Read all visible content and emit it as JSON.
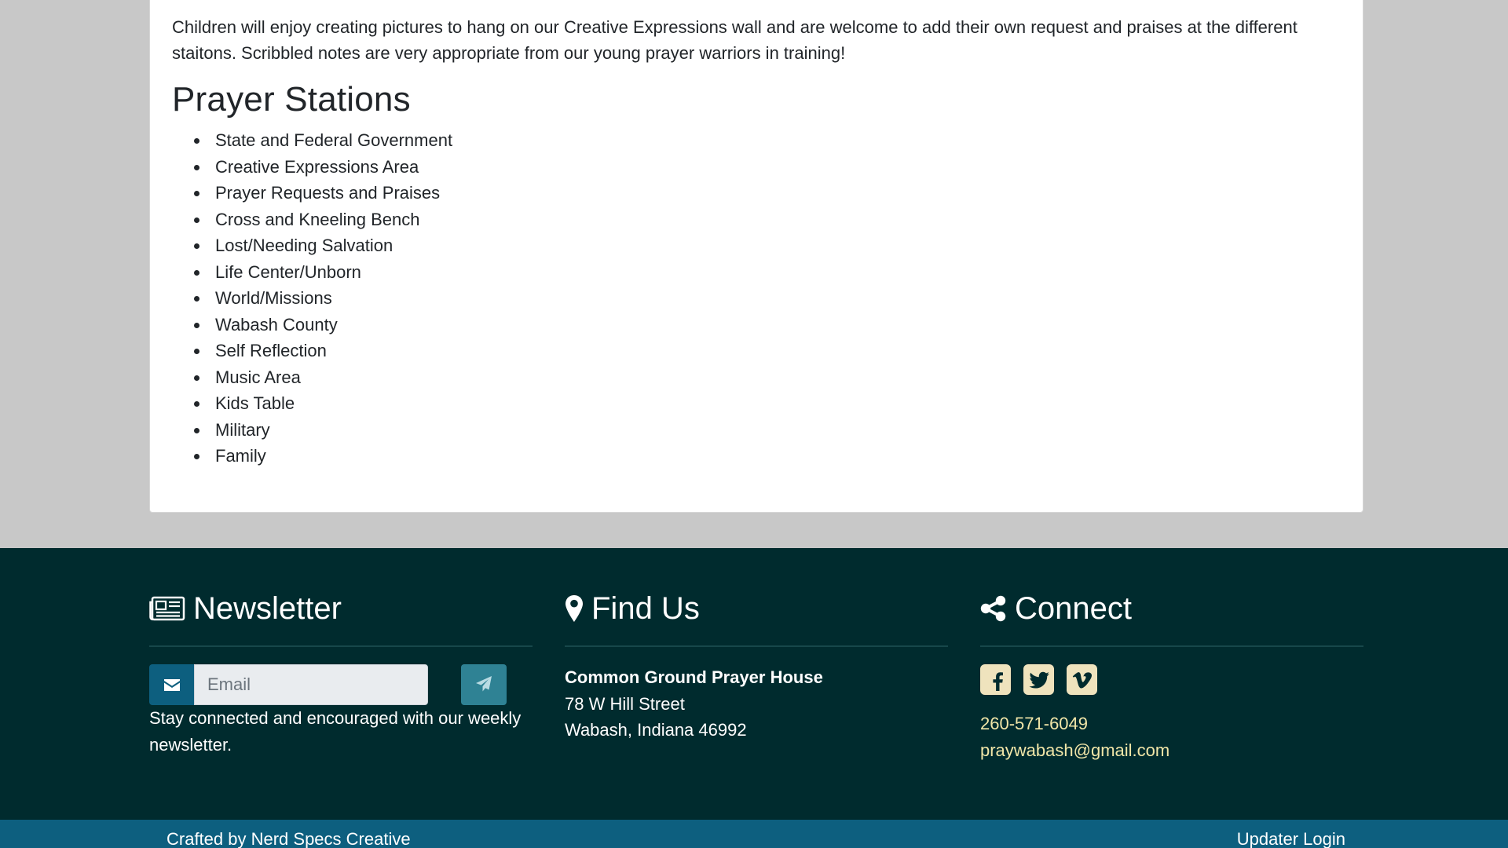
{
  "content": {
    "intro": "Children will enjoy creating pictures to hang on our Creative Expressions wall and are welcome to add their own request and praises at the different staitons. Scribbled notes are very appropriate from our young prayer warriors in training!",
    "stations_heading": "Prayer Stations",
    "stations": [
      "State and Federal Government",
      "Creative Expressions Area",
      "Prayer Requests and Praises",
      "Cross and Kneeling Bench",
      "Lost/Needing Salvation",
      "Life Center/Unborn",
      "World/Missions",
      "Wabash County",
      "Self Reflection",
      "Music Area",
      "Kids Table",
      "Military",
      "Family"
    ]
  },
  "footer": {
    "newsletter": {
      "title": "Newsletter",
      "icon": "newspaper-icon",
      "email_placeholder": "Email",
      "email_value": "",
      "description": "Stay connected and encouraged with our weekly newsletter."
    },
    "find_us": {
      "title": "Find Us",
      "icon": "map-marker-icon",
      "name": "Common Ground Prayer House",
      "street": "78 W Hill Street",
      "city": "Wabash, Indiana 46992"
    },
    "connect": {
      "title": "Connect",
      "icon": "share-icon",
      "social": [
        "facebook-icon",
        "twitter-icon",
        "vimeo-icon"
      ],
      "phone": "260-571-6049",
      "email": "praywabash@gmail.com"
    }
  },
  "bottom_bar": {
    "credit": "Crafted by Nerd Specs Creative",
    "updater_login": "Updater Login"
  },
  "colors": {
    "page_bg": "#c8c8c8",
    "footer_bg": "#002b2e",
    "bottom_bar_bg": "#0d5f7f",
    "link": "#f1e6a8",
    "social_bg": "#efe3bd"
  }
}
